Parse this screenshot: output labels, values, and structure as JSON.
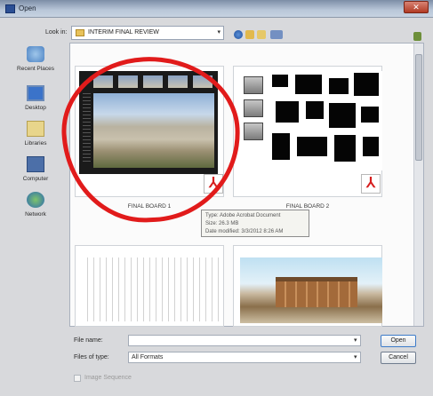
{
  "window": {
    "title": "Open",
    "close_label": "✕"
  },
  "toolbar": {
    "lookin_label": "Look in:",
    "lookin_value": "INTERIM FINAL REVIEW"
  },
  "places": [
    {
      "label": "Recent Places",
      "icon": "recent-places-icon"
    },
    {
      "label": "Desktop",
      "icon": "desktop-icon"
    },
    {
      "label": "Libraries",
      "icon": "libraries-icon"
    },
    {
      "label": "Computer",
      "icon": "computer-icon"
    },
    {
      "label": "Network",
      "icon": "network-icon"
    }
  ],
  "files": [
    {
      "name": "FINAL BOARD 1",
      "badge": "pdf-icon"
    },
    {
      "name": "FINAL BOARD 2",
      "badge": "pdf-icon"
    },
    {
      "name": "",
      "badge": ""
    },
    {
      "name": "",
      "badge": ""
    }
  ],
  "tooltip": {
    "type_line": "Type: Adobe Acrobat Document",
    "size_line": "Size: 26.3 MB",
    "date_line": "Date modified: 3/3/2012 8:26 AM"
  },
  "form": {
    "filename_label": "File name:",
    "filename_value": "",
    "filetype_label": "Files of type:",
    "filetype_value": "All Formats",
    "open_label": "Open",
    "cancel_label": "Cancel",
    "sequence_label": "Image Sequence"
  },
  "colors": {
    "annotation_ring": "#e11b1b",
    "pdf_badge": "#d61d1d"
  }
}
